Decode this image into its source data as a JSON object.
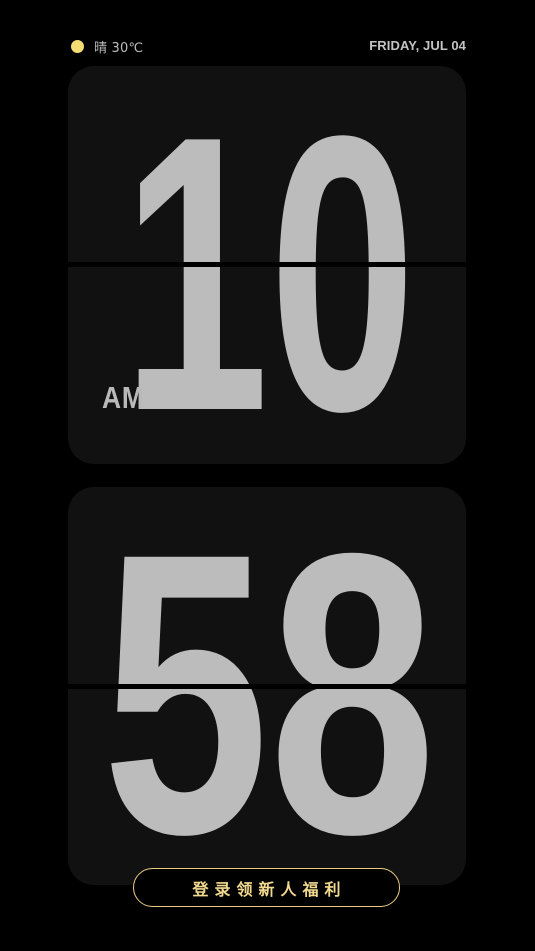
{
  "status": {
    "weather_icon": "sun-icon",
    "weather_text": "晴 30℃",
    "date": "FRIDAY, JUL 04"
  },
  "clock": {
    "hours": "10",
    "minutes": "58",
    "period": "AM"
  },
  "promo": {
    "label": "登录领新人福利"
  },
  "colors": {
    "background": "#000000",
    "card": "#111111",
    "digit": "#bcbcbc",
    "accent": "#f1d98f",
    "sun": "#f5dd75"
  }
}
